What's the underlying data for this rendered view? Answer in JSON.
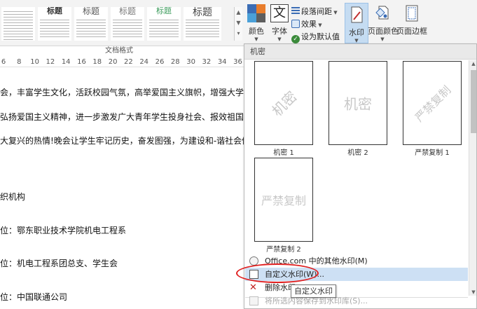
{
  "ribbon": {
    "style_gallery": [
      {
        "title": ""
      },
      {
        "title": "标题"
      },
      {
        "title": "标题"
      },
      {
        "title": "标题"
      },
      {
        "title": "标题"
      },
      {
        "title": "标题"
      },
      {
        "title": "标题"
      }
    ],
    "gallery_group_label": "文档格式",
    "colors_label": "颜色",
    "fonts_label": "字体",
    "fonts_glyph": "文",
    "paragraph_spacing_label": "段落间距",
    "effects_label": "效果",
    "set_default_label": "设为默认值",
    "watermark_label": "水印",
    "page_color_label": "页面颜色",
    "page_border_label": "页面边框",
    "accent_colors": [
      "#3b6db5",
      "#e87d2c",
      "#4aa0d8",
      "#5e5e5e"
    ]
  },
  "ruler": {
    "numbers": [
      "6",
      "8",
      "10",
      "12",
      "14",
      "16",
      "18",
      "20",
      "22",
      "24",
      "26",
      "28",
      "30",
      "32",
      "34",
      "36"
    ]
  },
  "document": {
    "lines": [
      "会，丰富学生文化，活跃校园气氛，高举爱国主义旗帜，增强大学生责",
      "弘扬爱国主义精神，进一步激发广大青年学生投身社会、报效祖国，奖",
      "大复兴的热情!晚会让学生牢记历史，奋发图强，为建设和-谐社会做出",
      "织机构",
      "位：鄂东职业技术学院机电工程系",
      "位：机电工程系团总支、学生会",
      "位：中国联通公司"
    ]
  },
  "watermark_panel": {
    "section_title": "机密",
    "items": [
      {
        "watermark_text": "机密",
        "label": "机密 1"
      },
      {
        "watermark_text": "机密",
        "label": "机密 2"
      },
      {
        "watermark_text": "严禁复制",
        "label": "严禁复制 1"
      },
      {
        "watermark_text": "严禁复制",
        "label": "严禁复制 2"
      }
    ],
    "menu": {
      "more_from_office": "Office.com 中的其他水印(M)",
      "custom_watermark": "自定义水印(W)...",
      "remove_watermark": "删除水印(R)",
      "save_selection": "将所选内容保存到水印库(S)..."
    },
    "tooltip": "自定义水印",
    "highlight_color": "#e02020"
  }
}
